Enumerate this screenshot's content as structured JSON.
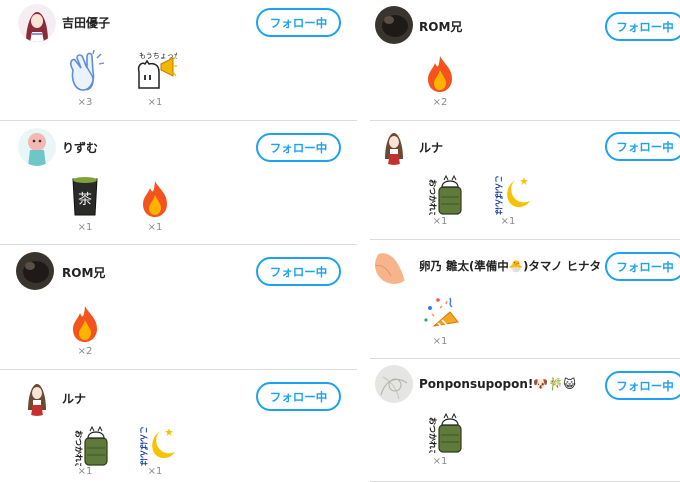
{
  "follow_label": "フォロー中",
  "left": [
    {
      "name": "吉田優子",
      "stamps": [
        {
          "icon": "clapping-hands-icon",
          "count": "×3"
        },
        {
          "icon": "yeah-cat-icon",
          "count": "×1",
          "text": "もうちょっかい"
        }
      ]
    },
    {
      "name": "りずむ",
      "stamps": [
        {
          "icon": "tea-cup-icon",
          "count": "×1",
          "text": "茶"
        },
        {
          "icon": "fire-icon",
          "count": "×1"
        }
      ]
    },
    {
      "name": "ROM兄",
      "stamps": [
        {
          "icon": "fire-icon",
          "count": "×2"
        }
      ]
    },
    {
      "name": "ルナ",
      "stamps": [
        {
          "icon": "oyasumi-cat-icon",
          "count": "×1",
          "text": "おつかれさま"
        },
        {
          "icon": "konbanwa-moon-icon",
          "count": "×1",
          "text": "こんばんは"
        }
      ]
    }
  ],
  "right": [
    {
      "name": "ROM兄",
      "stamps": [
        {
          "icon": "fire-icon",
          "count": "×2"
        }
      ]
    },
    {
      "name": "ルナ",
      "stamps": [
        {
          "icon": "oyasumi-cat-icon",
          "count": "×1",
          "text": "おつかれさま"
        },
        {
          "icon": "konbanwa-moon-icon",
          "count": "×1",
          "text": "こんばんは"
        }
      ]
    },
    {
      "name": "卵乃 雛太(準備中🐣)タマノ ヒナタ",
      "stamps": [
        {
          "icon": "party-popper-icon",
          "count": "×1"
        }
      ]
    },
    {
      "name": "Ponponsupopon!🐶🎋😺",
      "stamps": [
        {
          "icon": "oyasumi-cat-icon",
          "count": "×1",
          "text": "おつかれさま"
        }
      ]
    }
  ]
}
